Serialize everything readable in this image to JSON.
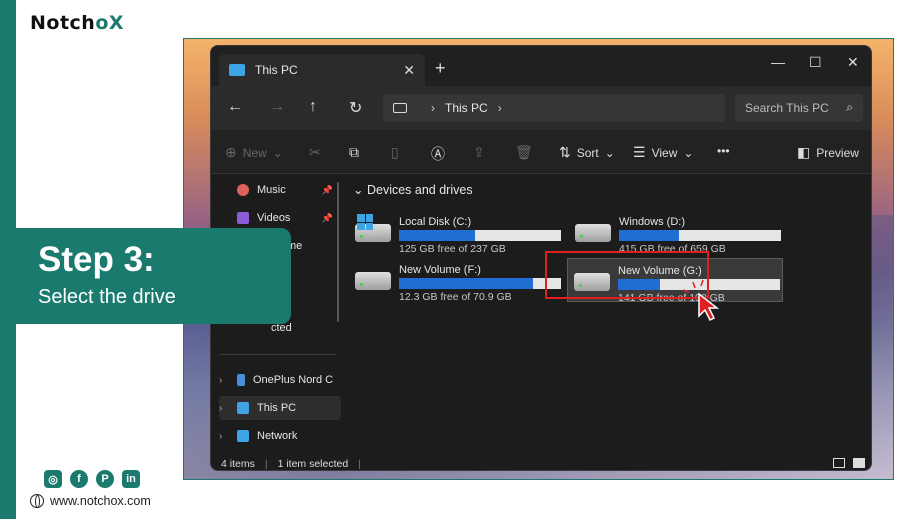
{
  "brand": {
    "logo_prefix": "Notch",
    "logo_o": "o",
    "logo_x": "X",
    "website": "www.notchox.com",
    "accent": "#1a7a6e"
  },
  "step": {
    "title": "Step 3:",
    "subtitle": "Select the drive"
  },
  "socials": [
    {
      "name": "instagram-icon",
      "glyph": "◎"
    },
    {
      "name": "facebook-icon",
      "glyph": "f"
    },
    {
      "name": "pinterest-icon",
      "glyph": "P"
    },
    {
      "name": "linkedin-icon",
      "glyph": "in"
    }
  ],
  "explorer": {
    "tab_title": "This PC",
    "new_tab": "+",
    "window_controls": [
      "—",
      "☐",
      "✕"
    ],
    "address": {
      "location": "This PC"
    },
    "search_placeholder": "Search This PC",
    "toolbar": {
      "new_label": "New",
      "sort_label": "Sort",
      "view_label": "View",
      "more": "•••",
      "preview_label": "Preview"
    },
    "sidebar": {
      "pinned": [
        {
          "label": "Music",
          "icon": "music-icon",
          "color": "#e0605a"
        },
        {
          "label": "Videos",
          "icon": "videos-icon",
          "color": "#8a5cd6"
        },
        {
          "label": "",
          "icon": "folder-icon",
          "color": "#e8b94a"
        }
      ],
      "partial_text": [
        "me",
        "s",
        "cted"
      ],
      "devices": [
        {
          "label": "OnePlus Nord C",
          "icon": "phone-icon",
          "color": "#4a8fd9"
        },
        {
          "label": "This PC",
          "icon": "this-pc-icon",
          "color": "#3fa4e6",
          "active": true
        },
        {
          "label": "Network",
          "icon": "network-icon",
          "color": "#3fa4e6"
        }
      ]
    },
    "section_title": "Devices and drives",
    "drives": [
      {
        "name": "Local Disk (C:)",
        "free": "125 GB free of 237 GB",
        "used_fraction": 0.47,
        "type": "windows",
        "selected": false
      },
      {
        "name": "Windows (D:)",
        "free": "415 GB free of 659 GB",
        "used_fraction": 0.37,
        "type": "hdd",
        "selected": false
      },
      {
        "name": "New Volume (F:)",
        "free": "12.3 GB free of 70.9 GB",
        "used_fraction": 0.83,
        "type": "hdd",
        "selected": false
      },
      {
        "name": "New Volume (G:)",
        "free": "141 GB free of 190 GB",
        "used_fraction": 0.26,
        "type": "hdd",
        "selected": true
      }
    ],
    "status": {
      "items": "4 items",
      "selected": "1 item selected"
    }
  }
}
